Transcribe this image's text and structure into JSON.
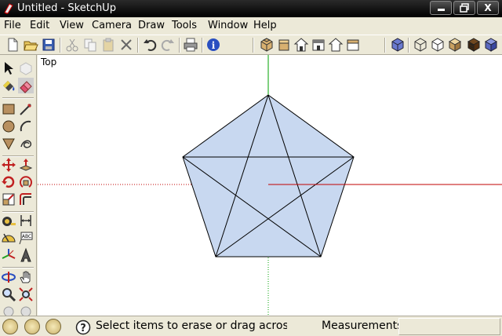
{
  "window": {
    "title": "Untitled - SketchUp",
    "controls": [
      "minimize-icon",
      "restore-icon",
      "close-icon"
    ],
    "close_glyph": "X"
  },
  "menu": {
    "items": [
      {
        "label": "File"
      },
      {
        "label": "Edit"
      },
      {
        "label": "View"
      },
      {
        "label": "Camera"
      },
      {
        "label": "Draw"
      },
      {
        "label": "Tools"
      },
      {
        "label": "Window"
      },
      {
        "label": "Help"
      }
    ]
  },
  "toolbar": {
    "icons": [
      "new-icon",
      "open-icon",
      "save-icon",
      "cut-icon",
      "copy-icon",
      "paste-icon",
      "erase-icon",
      "undo-icon",
      "redo-icon",
      "print-icon",
      "model-info-icon",
      "iso-view-icon",
      "top-view-icon",
      "front-view-icon",
      "right-view-icon",
      "back-view-icon",
      "left-view-icon",
      "xray-icon",
      "wireframe-icon",
      "hidden-line-icon",
      "shaded-icon",
      "shaded-textures-icon",
      "monochrome-icon"
    ]
  },
  "toolbox": {
    "icons": [
      "select-icon",
      "make-component-icon",
      "paint-bucket-icon",
      "eraser-icon",
      "rectangle-icon",
      "line-icon",
      "circle-icon",
      "arc-icon",
      "polygon-icon",
      "freehand-icon",
      "move-icon",
      "push-pull-icon",
      "rotate-icon",
      "follow-me-icon",
      "scale-icon",
      "offset-icon",
      "tape-measure-icon",
      "dimension-icon",
      "protractor-icon",
      "text-icon",
      "axes-icon",
      "3d-text-icon",
      "orbit-icon",
      "pan-icon",
      "zoom-icon",
      "zoom-extents-icon"
    ]
  },
  "viewport": {
    "view_label": "Top"
  },
  "status": {
    "hint": "Select items to erase or drag across m",
    "measurements_label": "Measurements",
    "measurements_value": ""
  },
  "colors": {
    "face_fill": "#c8d8f0",
    "axis_green": "#00a000",
    "axis_red": "#c00000"
  }
}
